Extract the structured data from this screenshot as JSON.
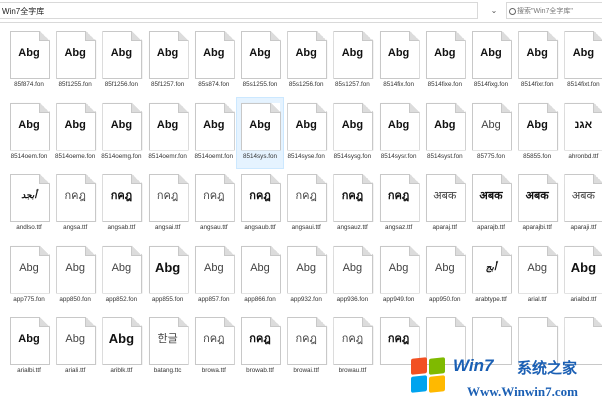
{
  "address": {
    "path": "Win7全字库"
  },
  "search": {
    "placeholder": "搜索\"Win7全字库\""
  },
  "rows": [
    [
      {
        "name": "85f874.fon",
        "glyph": "Abg"
      },
      {
        "name": "85f1255.fon",
        "glyph": "Abg"
      },
      {
        "name": "85f1256.fon",
        "glyph": "Abg"
      },
      {
        "name": "85f1257.fon",
        "glyph": "Abg"
      },
      {
        "name": "85s874.fon",
        "glyph": "Abg"
      },
      {
        "name": "85s1255.fon",
        "glyph": "Abg"
      },
      {
        "name": "85s1256.fon",
        "glyph": "Abg"
      },
      {
        "name": "85s1257.fon",
        "glyph": "Abg"
      },
      {
        "name": "8514fix.fon",
        "glyph": "Abg"
      },
      {
        "name": "8514fixe.fon",
        "glyph": "Abg"
      },
      {
        "name": "8514fixg.fon",
        "glyph": "Abg"
      },
      {
        "name": "8514fixr.fon",
        "glyph": "Abg"
      },
      {
        "name": "8514fixt.fon",
        "glyph": "Abg"
      }
    ],
    [
      {
        "name": "8514oem.fon",
        "glyph": "Abg"
      },
      {
        "name": "8514oeme.fon",
        "glyph": "Abg"
      },
      {
        "name": "8514oemg.fon",
        "glyph": "Abg"
      },
      {
        "name": "8514oemr.fon",
        "glyph": "Abg"
      },
      {
        "name": "8514oemt.fon",
        "glyph": "Abg"
      },
      {
        "name": "8514sys.fon",
        "glyph": "Abg",
        "selected": true
      },
      {
        "name": "8514syse.fon",
        "glyph": "Abg"
      },
      {
        "name": "8514sysg.fon",
        "glyph": "Abg"
      },
      {
        "name": "8514sysr.fon",
        "glyph": "Abg"
      },
      {
        "name": "8514syst.fon",
        "glyph": "Abg"
      },
      {
        "name": "85775.fon",
        "glyph": "Abg",
        "style": "reg"
      },
      {
        "name": "85855.fon",
        "glyph": "Abg"
      },
      {
        "name": "ahronbd.ttf",
        "glyph": "אגנ"
      }
    ],
    [
      {
        "name": "andlso.ttf",
        "glyph": "أبجد",
        "style": "script"
      },
      {
        "name": "angsa.ttf",
        "glyph": "กคฎ",
        "style": "reg"
      },
      {
        "name": "angsab.ttf",
        "glyph": "กคฎ"
      },
      {
        "name": "angsai.ttf",
        "glyph": "กคฎ",
        "style": "reg"
      },
      {
        "name": "angsau.ttf",
        "glyph": "กคฎ",
        "style": "reg"
      },
      {
        "name": "angsaub.ttf",
        "glyph": "กคฎ"
      },
      {
        "name": "angsaui.ttf",
        "glyph": "กคฎ",
        "style": "reg"
      },
      {
        "name": "angsauz.ttf",
        "glyph": "กคฎ"
      },
      {
        "name": "angsaz.ttf",
        "glyph": "กคฎ"
      },
      {
        "name": "aparaj.ttf",
        "glyph": "अबक",
        "style": "reg"
      },
      {
        "name": "aparajb.ttf",
        "glyph": "अबक"
      },
      {
        "name": "aparajbi.ttf",
        "glyph": "अबक"
      },
      {
        "name": "aparaji.ttf",
        "glyph": "अबक",
        "style": "reg"
      }
    ],
    [
      {
        "name": "app775.fon",
        "glyph": "Abg",
        "style": "reg"
      },
      {
        "name": "app850.fon",
        "glyph": "Abg",
        "style": "reg"
      },
      {
        "name": "app852.fon",
        "glyph": "Abg",
        "style": "reg"
      },
      {
        "name": "app855.fon",
        "glyph": "Abg",
        "style": "big"
      },
      {
        "name": "app857.fon",
        "glyph": "Abg",
        "style": "reg"
      },
      {
        "name": "app866.fon",
        "glyph": "Abg",
        "style": "reg"
      },
      {
        "name": "app932.fon",
        "glyph": "Abg",
        "style": "reg"
      },
      {
        "name": "app936.fon",
        "glyph": "Abg",
        "style": "reg"
      },
      {
        "name": "app949.fon",
        "glyph": "Abg",
        "style": "reg"
      },
      {
        "name": "app950.fon",
        "glyph": "Abg",
        "style": "reg"
      },
      {
        "name": "arabtype.ttf",
        "glyph": "أبج",
        "style": "script"
      },
      {
        "name": "arial.ttf",
        "glyph": "Abg",
        "style": "reg"
      },
      {
        "name": "arialbd.ttf",
        "glyph": "Abg",
        "style": "big"
      }
    ],
    [
      {
        "name": "arialbi.ttf",
        "glyph": "Abg"
      },
      {
        "name": "ariali.ttf",
        "glyph": "Abg",
        "style": "reg"
      },
      {
        "name": "ariblk.ttf",
        "glyph": "Abg",
        "style": "big"
      },
      {
        "name": "batang.ttc",
        "glyph": "한글",
        "style": "reg"
      },
      {
        "name": "browa.ttf",
        "glyph": "กคฎ",
        "style": "reg"
      },
      {
        "name": "browab.ttf",
        "glyph": "กคฎ"
      },
      {
        "name": "browai.ttf",
        "glyph": "กคฎ",
        "style": "reg"
      },
      {
        "name": "browau.ttf",
        "glyph": "กคฎ",
        "style": "reg"
      },
      {
        "name": "",
        "glyph": "กคฎ"
      },
      {
        "name": "",
        "glyph": ""
      },
      {
        "name": "",
        "glyph": ""
      },
      {
        "name": "",
        "glyph": ""
      },
      {
        "name": "",
        "glyph": ""
      }
    ]
  ],
  "watermark": {
    "brand": "Win7",
    "suffix": "系统之家",
    "url": "Www.Winwin7.com"
  }
}
